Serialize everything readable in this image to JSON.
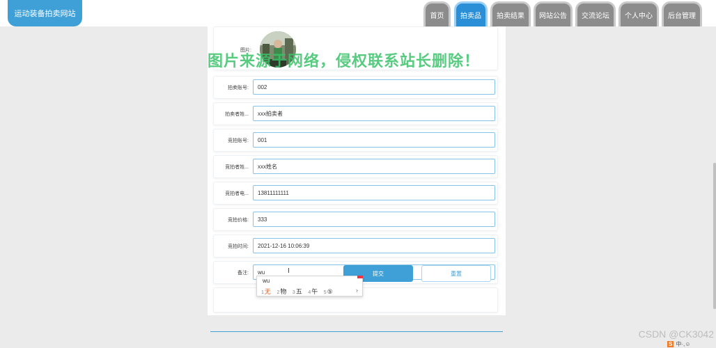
{
  "site": {
    "title": "运动装备拍卖网站"
  },
  "nav": {
    "tabs": [
      {
        "label": "首页",
        "active": false
      },
      {
        "label": "拍卖品",
        "active": true
      },
      {
        "label": "拍卖结果",
        "active": false
      },
      {
        "label": "网站公告",
        "active": false
      },
      {
        "label": "交流论坛",
        "active": false
      },
      {
        "label": "个人中心",
        "active": false
      },
      {
        "label": "后台管理",
        "active": false
      }
    ]
  },
  "form": {
    "photo_label": "图片:",
    "fields": [
      {
        "label": "拍卖账号:",
        "value": "002"
      },
      {
        "label": "拍卖者姓...",
        "value": "xxx拍卖者"
      },
      {
        "label": "竞拍账号:",
        "value": "001"
      },
      {
        "label": "竞拍者姓...",
        "value": "xxx姓名"
      },
      {
        "label": "竞拍者电...",
        "value": "13811111111"
      },
      {
        "label": "竞拍价格:",
        "value": "333"
      },
      {
        "label": "竞拍时间:",
        "value": "2021-12-16 10:06:39"
      },
      {
        "label": "备注:",
        "value": "wu"
      }
    ],
    "submit_label": "提交",
    "reset_label": "重置"
  },
  "watermark": "图片来源于网络，侵权联系站长删除！",
  "ime": {
    "typed": "wu",
    "candidates": [
      {
        "num": "1",
        "word": "无"
      },
      {
        "num": "2",
        "word": "物"
      },
      {
        "num": "3",
        "word": "五"
      },
      {
        "num": "4",
        "word": "午"
      },
      {
        "num": "5",
        "word": "⑤"
      }
    ],
    "next": "›"
  },
  "footer": {
    "credit": "CSDN @CK3042"
  },
  "tray": {
    "badge": "S",
    "text": "中·,☺"
  },
  "colors": {
    "accent": "#3fa0d8",
    "nav_inactive": "#8c8c8c",
    "watermark": "#3bc36b"
  }
}
